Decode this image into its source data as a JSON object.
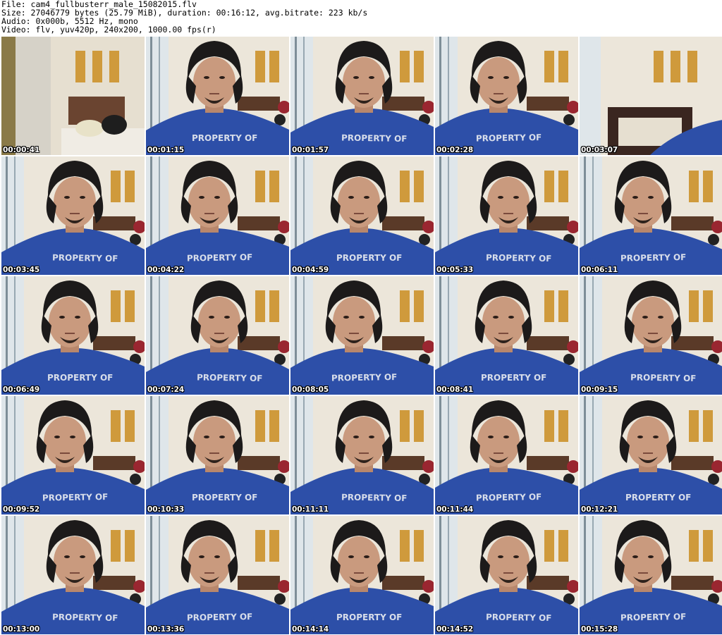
{
  "header": {
    "file": "File: cam4_fullbusterr_male_15082015.flv",
    "size": "Size: 27046779 bytes (25.79 MiB), duration: 00:16:12, avg.bitrate: 223 kb/s",
    "audio": "Audio: 0x000b, 5512 Hz, mono",
    "video": "Video: flv, yuv420p, 240x200, 1000.00 fps(r)"
  },
  "shirt_text": "PROPERTY OF",
  "colors": {
    "shirt": "#2d4fa8",
    "wall": "#ece6da",
    "hair": "#1c1a1a",
    "skin": "#c99a7e",
    "frame": "#cf9a3c"
  },
  "frames": [
    {
      "time": "00:00:41",
      "kind": "room"
    },
    {
      "time": "00:01:15",
      "kind": "person"
    },
    {
      "time": "00:01:57",
      "kind": "person"
    },
    {
      "time": "00:02:28",
      "kind": "person"
    },
    {
      "time": "00:03:07",
      "kind": "chair"
    },
    {
      "time": "00:03:45",
      "kind": "person"
    },
    {
      "time": "00:04:22",
      "kind": "person"
    },
    {
      "time": "00:04:59",
      "kind": "person"
    },
    {
      "time": "00:05:33",
      "kind": "person"
    },
    {
      "time": "00:06:11",
      "kind": "person"
    },
    {
      "time": "00:06:49",
      "kind": "person"
    },
    {
      "time": "00:07:24",
      "kind": "person"
    },
    {
      "time": "00:08:05",
      "kind": "person"
    },
    {
      "time": "00:08:41",
      "kind": "person"
    },
    {
      "time": "00:09:15",
      "kind": "person"
    },
    {
      "time": "00:09:52",
      "kind": "person"
    },
    {
      "time": "00:10:33",
      "kind": "person"
    },
    {
      "time": "00:11:11",
      "kind": "person"
    },
    {
      "time": "00:11:44",
      "kind": "person"
    },
    {
      "time": "00:12:21",
      "kind": "person"
    },
    {
      "time": "00:13:00",
      "kind": "person"
    },
    {
      "time": "00:13:36",
      "kind": "person"
    },
    {
      "time": "00:14:14",
      "kind": "person"
    },
    {
      "time": "00:14:52",
      "kind": "person"
    },
    {
      "time": "00:15:28",
      "kind": "person"
    }
  ]
}
